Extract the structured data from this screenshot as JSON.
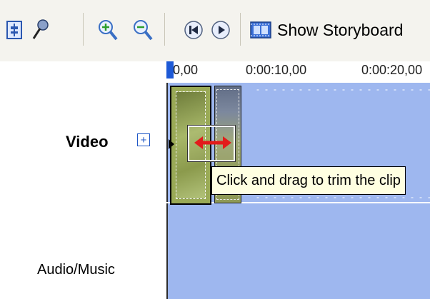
{
  "toolbar": {
    "buttons": [
      {
        "name": "set-audio-levels-icon"
      },
      {
        "name": "narrate-timeline-icon"
      },
      {
        "name": "zoom-in-icon"
      },
      {
        "name": "zoom-out-icon"
      },
      {
        "name": "rewind-icon"
      },
      {
        "name": "play-icon"
      }
    ],
    "storyboard_label": "Show Storyboard"
  },
  "ruler": {
    "ticks": [
      "0,00",
      "0:00:10,00",
      "0:00:20,00"
    ]
  },
  "tracks": {
    "video_label": "Video",
    "audio_label": "Audio/Music",
    "expand_symbol": "+"
  },
  "tooltip": {
    "text": "Click and drag to trim the clip"
  },
  "colors": {
    "timeline_bg": "#9eb7ef",
    "playhead": "#1d59d6",
    "trim_arrow": "#e21b1b",
    "tooltip_bg": "#ffffe1"
  }
}
